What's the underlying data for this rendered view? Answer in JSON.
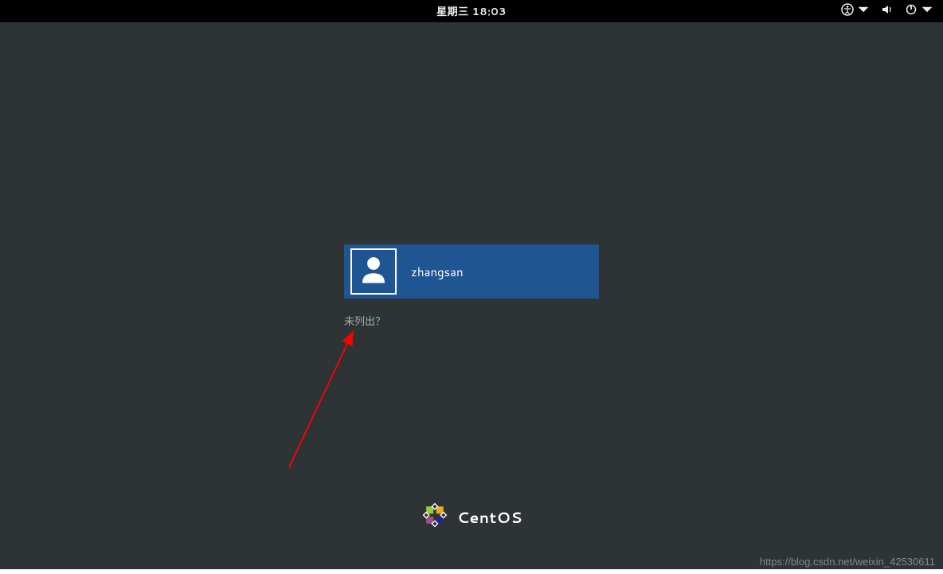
{
  "topbar": {
    "datetime": "星期三 18:03"
  },
  "login": {
    "username": "zhangsan",
    "not_listed": "未列出？"
  },
  "branding": {
    "name": "CentOS"
  },
  "watermark": "https://blog.csdn.net/weixin_42530611"
}
